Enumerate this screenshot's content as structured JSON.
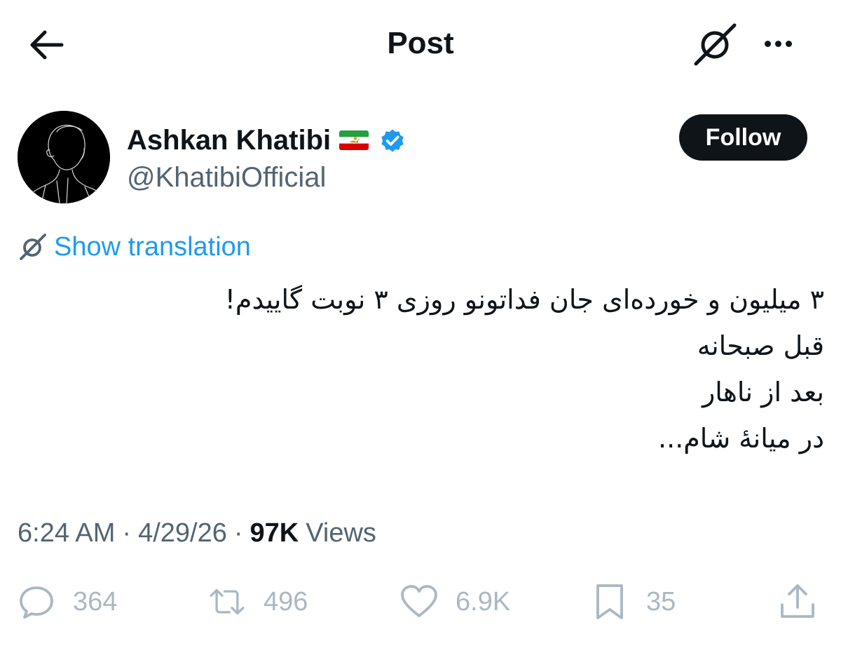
{
  "header": {
    "title": "Post",
    "back_icon": "arrow-left-icon",
    "grok_icon": "grok-icon",
    "more_icon": "more-horizontal-icon"
  },
  "author": {
    "name": "Ashkan Khatibi",
    "handle": "@KhatibiOfficial",
    "flag_icon": "iran-lion-and-sun-flag-icon",
    "verified_icon": "verified-badge-icon",
    "follow_label": "Follow"
  },
  "translation": {
    "label": "Show translation",
    "icon": "grok-icon"
  },
  "tweet": {
    "lines": [
      "۳ میلیون و خورده‌ای جان فداتونو روزی ۳ نوبت گاییدم!",
      "قبل صبحانه",
      "بعد از ناهار",
      "در میانهٔ شام..."
    ]
  },
  "meta": {
    "time": "6:24 AM",
    "separator": "·",
    "date": "4/29/26",
    "views_count": "97K",
    "views_label": "Views"
  },
  "actions": {
    "replies": "364",
    "reposts": "496",
    "likes": "6.9K",
    "bookmarks": "35"
  },
  "colors": {
    "text": "#0f1419",
    "secondary": "#536471",
    "accent": "#1d9bf0",
    "action_gray": "#aab8c2",
    "follow_bg": "#0f1419"
  }
}
